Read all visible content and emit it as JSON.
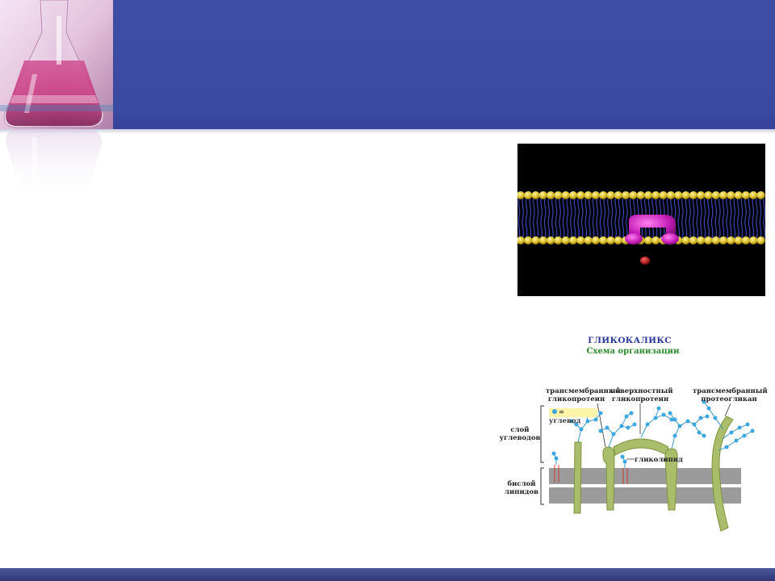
{
  "slide": {
    "colors": {
      "header": "#3b4ba2",
      "footer": "#2e3878",
      "background": "#ffffff"
    },
    "decorations": [
      "flask-photo",
      "flask-reflection"
    ]
  },
  "membrane_image": {
    "description": "animated lipid bilayer with magenta channel protein and red ion"
  },
  "glycocalyx_figure": {
    "title": "ГЛИКОКАЛИКС",
    "subtitle": "Схема организации",
    "labels": {
      "tm_glycoprotein": [
        "трансмембранный",
        "гликопротеин"
      ],
      "surface_glycoprotein": [
        "поверхностный",
        "гликопротеин"
      ],
      "tm_proteoglycan": [
        "трансмембранный",
        "протеогликан"
      ],
      "carb_layer": [
        "слой",
        "углеводов"
      ],
      "lipid_bilayer": [
        "бислой",
        "липидов"
      ],
      "glycolipid": "гликолипид",
      "legend": "= углевод"
    },
    "colors": {
      "protein": "#a9bd6a",
      "carbohydrate": "#3aa7e0",
      "bilayer": "#9b9b9b",
      "legend_bg": "#fff5a8"
    }
  }
}
